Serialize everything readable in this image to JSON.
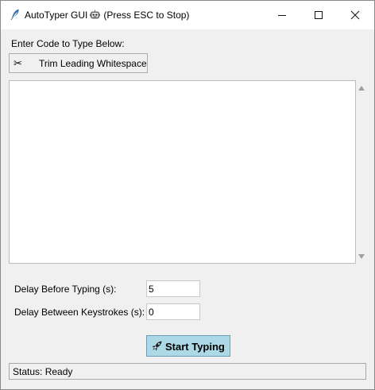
{
  "window": {
    "title": "AutoTyper GUI",
    "title_suffix": "(Press ESC to Stop)",
    "title_icon": "feather-icon",
    "title_robot_icon": "robot-icon",
    "controls": [
      "minimize",
      "maximize",
      "close"
    ]
  },
  "editor": {
    "prompt_label": "Enter Code to Type Below:",
    "trim_button": {
      "icon": "✂",
      "label": "Trim Leading Whitespace"
    },
    "code_text": ""
  },
  "settings": {
    "delay_before_label": "Delay Before Typing (s):",
    "delay_before_value": "5",
    "delay_between_label": "Delay Between Keystrokes (s):",
    "delay_between_value": "0"
  },
  "actions": {
    "start_label": "Start Typing",
    "start_icon": "rocket-icon",
    "start_color": "#add8e6"
  },
  "status": {
    "text": "Status: Ready"
  }
}
